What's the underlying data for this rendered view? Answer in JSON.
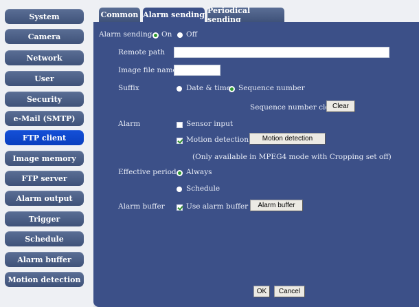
{
  "sidebar": {
    "items": [
      {
        "label": "System"
      },
      {
        "label": "Camera"
      },
      {
        "label": "Network"
      },
      {
        "label": "User"
      },
      {
        "label": "Security"
      },
      {
        "label": "e-Mail (SMTP)"
      },
      {
        "label": "FTP client",
        "active": true
      },
      {
        "label": "Image memory"
      },
      {
        "label": "FTP server"
      },
      {
        "label": "Alarm output"
      },
      {
        "label": "Trigger"
      },
      {
        "label": "Schedule"
      },
      {
        "label": "Alarm buffer"
      },
      {
        "label": "Motion detection"
      }
    ]
  },
  "tabs": [
    {
      "label": "Common"
    },
    {
      "label": "Alarm sending",
      "active": true
    },
    {
      "label": "Periodical sending"
    }
  ],
  "form": {
    "alarm_sending": {
      "label": "Alarm sending",
      "on": "On",
      "off": "Off",
      "value": "On"
    },
    "remote_path": {
      "label": "Remote path",
      "value": ""
    },
    "image_file_name": {
      "label": "Image file name",
      "value": ""
    },
    "suffix": {
      "label": "Suffix",
      "opt_date": "Date & time",
      "opt_seq": "Sequence number",
      "value": "Sequence number"
    },
    "seq_clear": {
      "label": "Sequence number clear",
      "button": "Clear"
    },
    "alarm": {
      "label": "Alarm",
      "sensor_input": {
        "label": "Sensor input",
        "checked": false
      },
      "motion_detection": {
        "label": "Motion detection",
        "checked": true,
        "button": "Motion detection"
      },
      "note": "(Only available in MPEG4 mode with Cropping set off)"
    },
    "effective_period": {
      "label": "Effective period",
      "opt_always": "Always",
      "opt_schedule": "Schedule",
      "value": "Always"
    },
    "alarm_buffer": {
      "label": "Alarm buffer",
      "use_label": "Use alarm buffer",
      "checked": true,
      "button": "Alarm buffer"
    }
  },
  "footer": {
    "ok": "OK",
    "cancel": "Cancel"
  },
  "colors": {
    "panel": "#3c5088",
    "sidebar_btn": "#4b5f88",
    "sidebar_active": "#0f49d0",
    "radio_dot": "#2d9a2d"
  }
}
